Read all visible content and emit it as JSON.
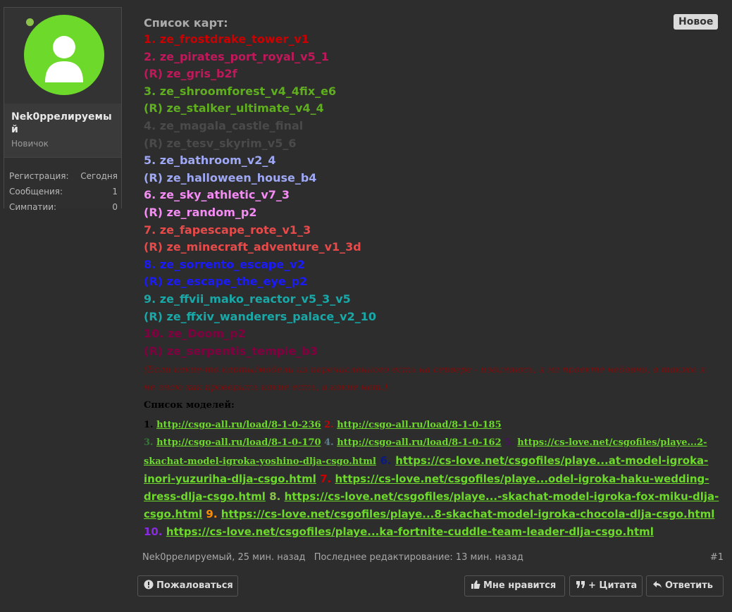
{
  "user": {
    "name": "Nek0ррелируемый",
    "title": "Новичок",
    "stats": [
      {
        "label": "Регистрация:",
        "value": "Сегодня"
      },
      {
        "label": "Сообщения:",
        "value": "1"
      },
      {
        "label": "Симпатии:",
        "value": "0"
      }
    ]
  },
  "badge": {
    "new": "Новое"
  },
  "maps_header": "Список карт:",
  "maps": [
    {
      "text": "1. ze_frostdrake_tower_v1",
      "color": "#cc0000"
    },
    {
      "text": "2. ze_pirates_port_royal_v5_1",
      "color": "#c2185b"
    },
    {
      "text": "(R) ze_gris_b2f",
      "color": "#c2185b"
    },
    {
      "text": "3. ze_shroomforest_v4_4fix_e6",
      "color": "#5fae1f"
    },
    {
      "text": "(R) ze_stalker_ultimate_v4_4",
      "color": "#5fae1f"
    },
    {
      "text": "4. ze_magala_castle_final",
      "color": "#4a4a4a"
    },
    {
      "text": "(R) ze_tesv_skyrim_v5_6",
      "color": "#4a4a4a"
    },
    {
      "text": "5. ze_bathroom_v2_4",
      "color": "#9fa8f5"
    },
    {
      "text": "(R) ze_halloween_house_b4",
      "color": "#9fa8f5"
    },
    {
      "text": "6. ze_sky_athletic_v7_3",
      "color": "#f58cf5"
    },
    {
      "text": "(R) ze_random_p2",
      "color": "#f58cf5"
    },
    {
      "text": "7. ze_fapescape_rote_v1_3",
      "color": "#e84a4a"
    },
    {
      "text": "(R) ze_minecraft_adventure_v1_3d",
      "color": "#e84a4a"
    },
    {
      "text": "8. ze_sorrento_escape_v2",
      "color": "#1a1aff"
    },
    {
      "text": "(R) ze_escape_the_eye_p2",
      "color": "#1a1aff"
    },
    {
      "text": "9. ze_ffvii_mako_reactor_v5_3_v5",
      "color": "#18a8a8"
    },
    {
      "text": "(R) ze_ffxiv_wanderers_palace_v2_10",
      "color": "#18a8a8"
    },
    {
      "text": "10. ze_Doom_p2",
      "color": "#800040"
    },
    {
      "text": "(R) ze_serpentis_temple_b3",
      "color": "#800040"
    }
  ],
  "note_lines": [
    "(Если какие-то карты/модели из перечисленного есть на сервере - извиняюсь, я на проекте недавно, а также я",
    "не знаю как проверить какие есть, а какие нет.)"
  ],
  "models_header": "Список моделей:",
  "models": {
    "m1_num": "1.",
    "m1_link": "http://csgo-all.ru/load/8-1-0-236",
    "m2_num": "2.",
    "m2_link": "http://csgo-all.ru/load/8-1-0-185",
    "m3_num": "3.",
    "m3_link": "http://csgo-all.ru/load/8-1-0-170",
    "m4_num": "4.",
    "m4_link": "http://csgo-all.ru/load/8-1-0-162",
    "m5_num": "5.",
    "m5_link_a": "https://cs-love.net/csgofiles/playe...2-",
    "m5_link_b": "skachat-model-igroka-yoshino-dlja-csgo.html",
    "m6_num": "6.",
    "m6_link_a": "https://cs-love.net/csgofiles/playe...at-model-igroka-",
    "m6_link_b": "inori-yuzuriha-dlja-csgo.html",
    "m7_num": "7.",
    "m7_link_a": "https://cs-love.net/csgofiles/playe...odel-igroka-haku-wedding-",
    "m7_link_b": "dress-dlja-csgo.html",
    "m8_num": "8.",
    "m8_link_a": "https://cs-love.net/csgofiles/playe...-skachat-model-igroka-fox-miku-dlja-",
    "m8_link_b": "csgo.html",
    "m9_num": "9.",
    "m9_link": "https://cs-love.net/csgofiles/playe...8-skachat-model-igroka-chocola-dlja-csgo.html",
    "m10_num": "10.",
    "m10_link": "https://cs-love.net/csgofiles/playe...ka-fortnite-cuddle-team-leader-dlja-csgo.html"
  },
  "meta": {
    "author_time": "Nek0ррелируемый, 25 мин. назад",
    "edited": "Последнее редактирование: 13 мин. назад",
    "post_number": "#1"
  },
  "buttons": {
    "report": "Пожаловаться",
    "like": "Мне нравится",
    "quote": "+ Цитата",
    "reply": "Ответить"
  },
  "colors": {
    "background": "#2d2d2d",
    "link_green": "#6dd92b",
    "avatar_green": "#6dd92b",
    "online_dot": "#8bc34a"
  }
}
